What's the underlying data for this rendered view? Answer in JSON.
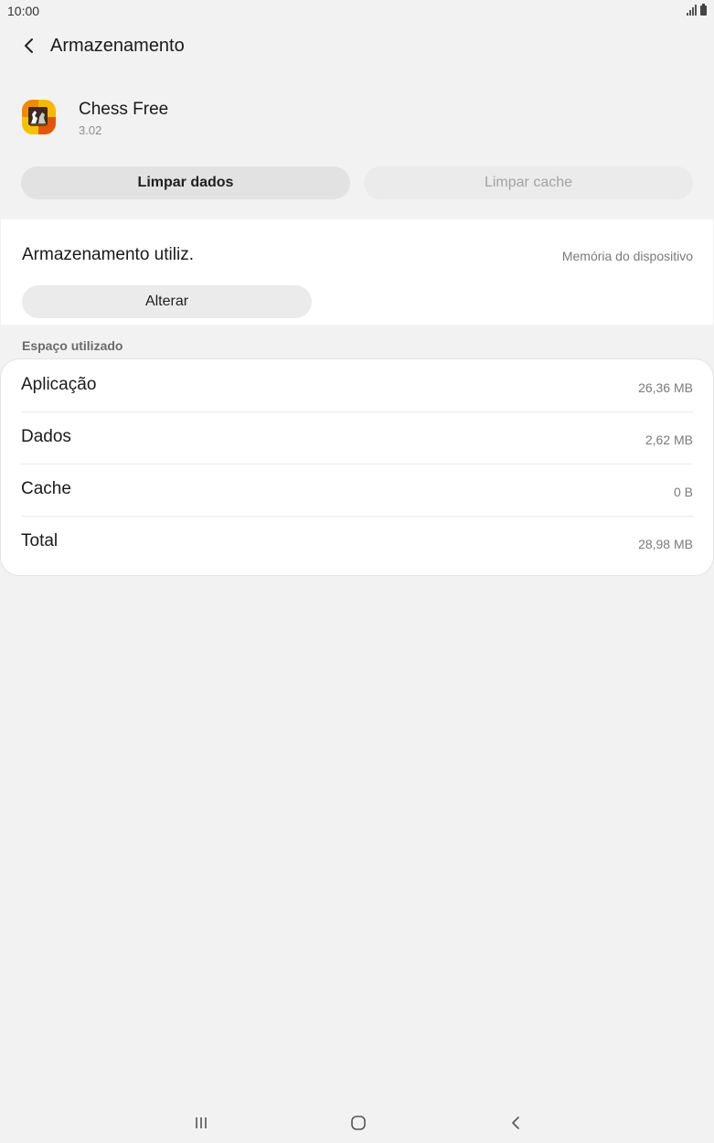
{
  "status_bar": {
    "time": "10:00"
  },
  "header": {
    "title": "Armazenamento"
  },
  "app": {
    "name": "Chess Free",
    "version": "3.02"
  },
  "actions": {
    "clear_data": "Limpar dados",
    "clear_cache": "Limpar cache"
  },
  "storage": {
    "label": "Armazenamento utiliz.",
    "location": "Memória do dispositivo",
    "change_button": "Alterar"
  },
  "space_used": {
    "title": "Espaço utilizado",
    "rows": [
      {
        "label": "Aplicação",
        "value": "26,36 MB"
      },
      {
        "label": "Dados",
        "value": "2,62 MB"
      },
      {
        "label": "Cache",
        "value": "0 B"
      },
      {
        "label": "Total",
        "value": "28,98 MB"
      }
    ]
  },
  "icons": {
    "back": "back-arrow-icon",
    "recents": "recent-apps-icon",
    "home": "home-icon",
    "nav_back": "nav-back-icon"
  }
}
